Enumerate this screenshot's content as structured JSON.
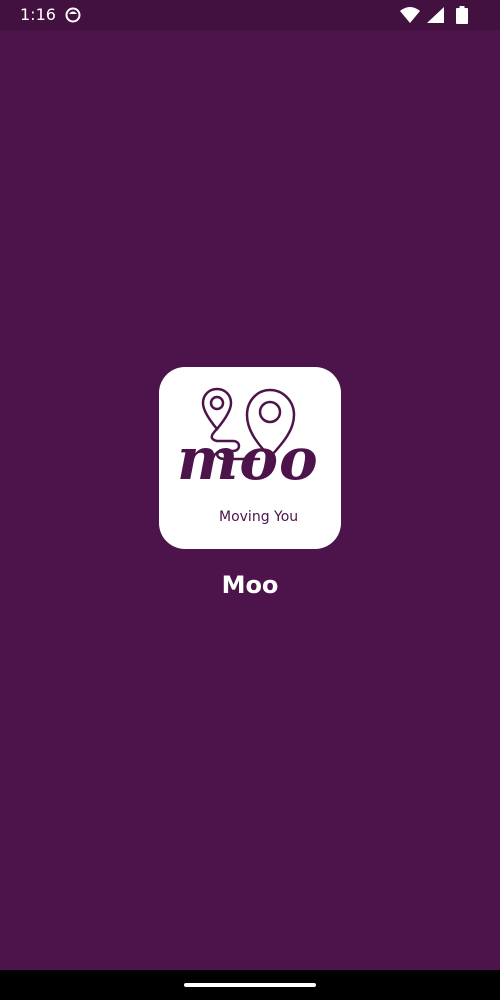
{
  "status_bar": {
    "time": "1:16",
    "app_icon": "app-notification-icon",
    "icons": [
      "wifi-icon",
      "signal-icon",
      "battery-icon"
    ]
  },
  "splash": {
    "logo": {
      "wordmark": "moo",
      "tagline": "Moving You",
      "icons": [
        "map-pin-small-icon",
        "map-pin-large-icon",
        "route-line"
      ]
    },
    "app_name": "Moo"
  },
  "colors": {
    "background": "#4d144b",
    "status_bar": "#431140",
    "logo_tile": "#ffffff",
    "brand": "#4d144b",
    "nav_bar": "#000000"
  }
}
